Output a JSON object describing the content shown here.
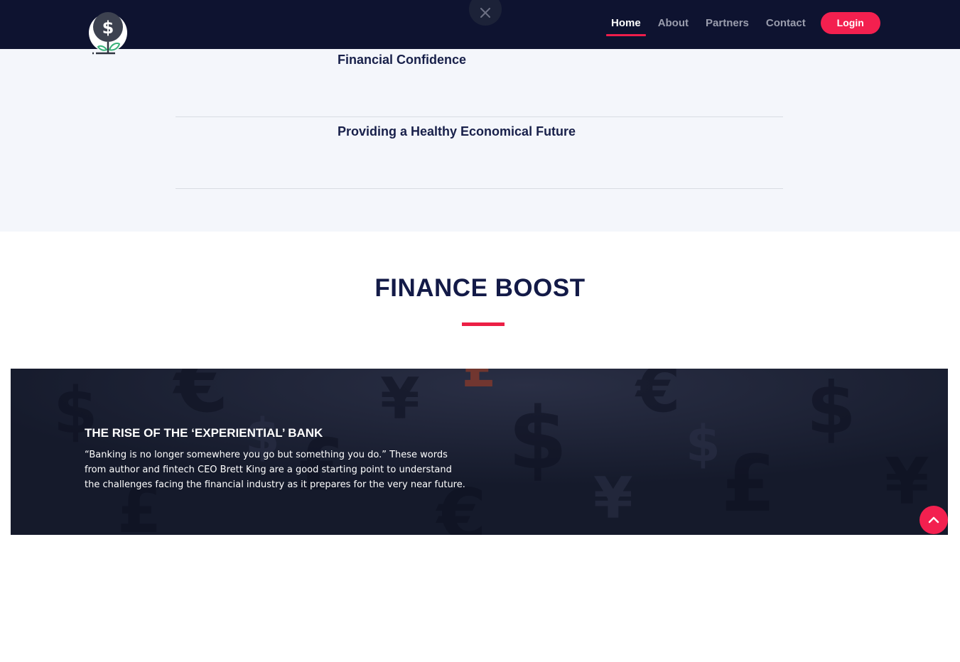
{
  "nav": {
    "items": [
      {
        "label": "Home",
        "active": true
      },
      {
        "label": "About",
        "active": false
      },
      {
        "label": "Partners",
        "active": false
      },
      {
        "label": "Contact",
        "active": false
      }
    ],
    "login_label": "Login"
  },
  "accordion": {
    "items": [
      {
        "title": "Financial Confidence"
      },
      {
        "title": "Providing a Healthy Economical Future"
      }
    ]
  },
  "finance_boost": {
    "heading": "FINANCE BOOST"
  },
  "banner": {
    "title": "THE RISE OF THE ‘EXPERIENTIAL’ BANK",
    "text": "“Banking is no longer somewhere you go but something you do.” These words from author and fintech CEO Brett King are a good starting point to understand the challenges facing the financial industry as it prepares for the very near future."
  },
  "icons": {
    "logo": "dollar-plant-icon",
    "close": "close-icon",
    "scroll_top": "chevron-up-icon"
  },
  "colors": {
    "navbar_bg": "#0e1330",
    "accent": "#f3204f",
    "heading": "#131a47",
    "section_bg": "#f4f6fb",
    "banner_bg": "#171b2d"
  }
}
